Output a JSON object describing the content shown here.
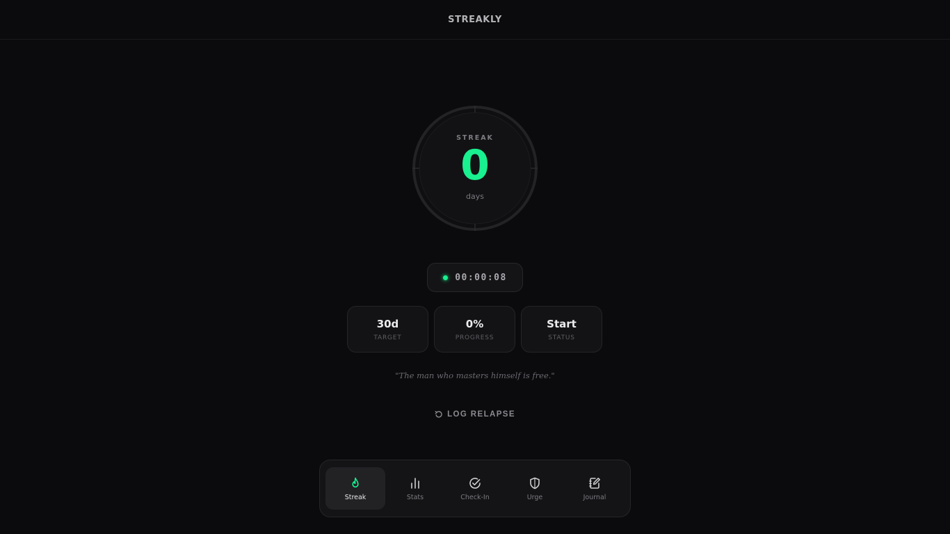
{
  "app": {
    "title": "STREAKLY"
  },
  "streak": {
    "label": "STREAK",
    "value": "0",
    "unit": "days"
  },
  "timer": {
    "value": "00:00:08",
    "status_color": "#19f08f"
  },
  "stats": [
    {
      "value": "30d",
      "label": "TARGET"
    },
    {
      "value": "0%",
      "label": "PROGRESS"
    },
    {
      "value": "Start",
      "label": "STATUS"
    }
  ],
  "quote": "\"The man who masters himself is free.\"",
  "relapse": {
    "label": "LOG RELAPSE",
    "icon": "reset-icon"
  },
  "nav": {
    "items": [
      {
        "label": "Streak",
        "icon": "flame-icon",
        "active": true
      },
      {
        "label": "Stats",
        "icon": "bar-chart-icon",
        "active": false
      },
      {
        "label": "Check-In",
        "icon": "check-circle-icon",
        "active": false
      },
      {
        "label": "Urge",
        "icon": "shield-icon",
        "active": false
      },
      {
        "label": "Journal",
        "icon": "journal-edit-icon",
        "active": false
      }
    ]
  },
  "colors": {
    "accent": "#19f08f",
    "background": "#0b0b0d",
    "card": "#131315"
  }
}
